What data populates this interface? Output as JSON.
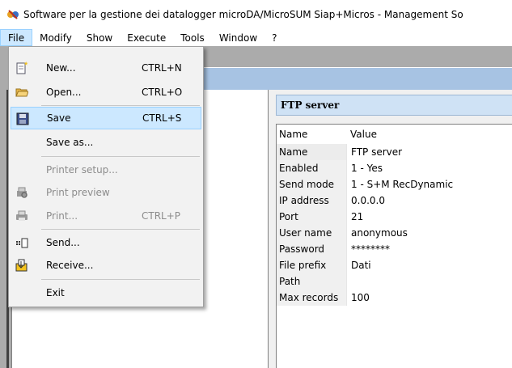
{
  "window": {
    "title": "Software per la gestione dei datalogger microDA/MicroSUM Siap+Micros - Management So"
  },
  "menubar": {
    "file": "File",
    "modify": "Modify",
    "show": "Show",
    "execute": "Execute",
    "tools": "Tools",
    "window": "Window",
    "help": "?"
  },
  "file_menu": {
    "items": [
      {
        "label": "New...",
        "shortcut": "CTRL+N",
        "icon": "new-file-icon"
      },
      {
        "label": "Open...",
        "shortcut": "CTRL+O",
        "icon": "folder-open-icon"
      },
      {
        "label": "Save",
        "shortcut": "CTRL+S",
        "icon": "floppy-disk-icon"
      },
      {
        "label": "Save as...",
        "shortcut": "",
        "icon": ""
      },
      {
        "label": "Printer setup...",
        "shortcut": "",
        "icon": ""
      },
      {
        "label": "Print preview",
        "shortcut": "",
        "icon": "print-preview-icon"
      },
      {
        "label": "Print...",
        "shortcut": "CTRL+P",
        "icon": "printer-icon"
      },
      {
        "label": "Send...",
        "shortcut": "",
        "icon": "send-icon"
      },
      {
        "label": "Receive...",
        "shortcut": "",
        "icon": "receive-icon"
      },
      {
        "label": "Exit",
        "shortcut": "",
        "icon": ""
      }
    ]
  },
  "panel": {
    "header": "FTP server",
    "columns": {
      "name": "Name",
      "value": "Value"
    },
    "rows": [
      {
        "name": "Name",
        "value": "FTP server"
      },
      {
        "name": "Enabled",
        "value": "1 - Yes"
      },
      {
        "name": "Send mode",
        "value": "1 - S+M RecDynamic"
      },
      {
        "name": "IP address",
        "value": "0.0.0.0"
      },
      {
        "name": "Port",
        "value": "21"
      },
      {
        "name": "User name",
        "value": "anonymous"
      },
      {
        "name": "Password",
        "value": "********"
      },
      {
        "name": "File prefix",
        "value": "Dati"
      },
      {
        "name": "Path",
        "value": ""
      },
      {
        "name": "Max records",
        "value": "100"
      }
    ]
  },
  "colors": {
    "highlight": "#cce8ff",
    "highlight_border": "#99d1ff",
    "toolbar_strip": "#a7c3e3",
    "panel_header": "#cfe2f5",
    "workspace": "#ababab"
  }
}
